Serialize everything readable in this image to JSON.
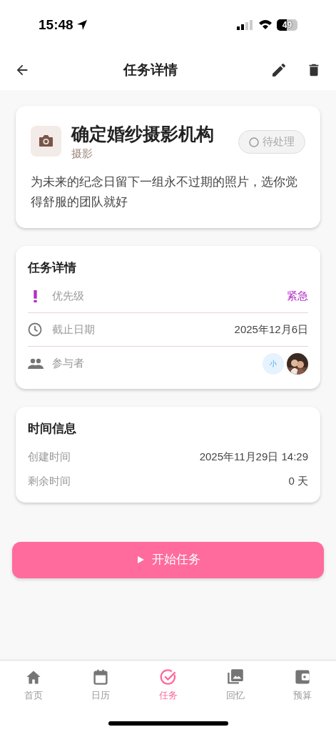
{
  "status_bar": {
    "time": "15:48",
    "battery": "49"
  },
  "header": {
    "title": "任务详情"
  },
  "task": {
    "title": "确定婚纱摄影机构",
    "category": "摄影",
    "status": "待处理",
    "description": "为未来的纪念日留下一组永不过期的照片，选你觉得舒服的团队就好"
  },
  "details": {
    "title": "任务详情",
    "rows": [
      {
        "kind": "priority",
        "label": "优先级",
        "value": "紧急",
        "color": "#b02cc5"
      },
      {
        "kind": "date",
        "label": "截止日期",
        "value": "2025年12月6日"
      },
      {
        "kind": "participants",
        "label": "参与者",
        "avatars": [
          {
            "kind": "initial",
            "text": "小"
          },
          {
            "kind": "picture"
          }
        ]
      }
    ]
  },
  "time_info": {
    "title": "时间信息",
    "rows": [
      {
        "label": "创建时间",
        "value": "2025年11月29日 14:29"
      },
      {
        "label": "剩余时间",
        "value": "0 天"
      }
    ]
  },
  "start_button": {
    "label": "开始任务"
  },
  "tabs": [
    {
      "kind": "home",
      "label": "首页",
      "selected": false
    },
    {
      "kind": "calendar",
      "label": "日历",
      "selected": false
    },
    {
      "kind": "tasks",
      "label": "任务",
      "selected": true
    },
    {
      "kind": "memories",
      "label": "回忆",
      "selected": false
    },
    {
      "kind": "budget",
      "label": "预算",
      "selected": false
    }
  ]
}
